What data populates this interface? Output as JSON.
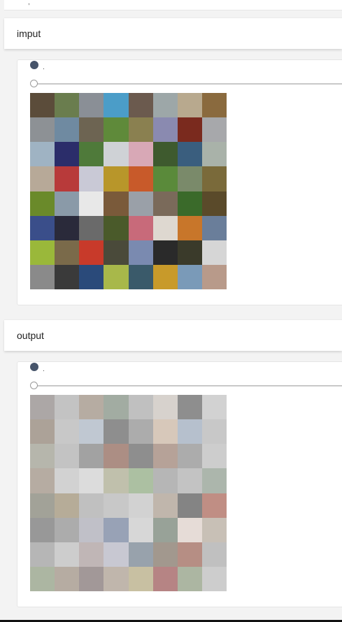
{
  "top": {
    "fragment": ","
  },
  "input_section": {
    "title": "imput",
    "radio_label": ".",
    "slider_value": 0,
    "grid_colors": [
      "#5b4c3a",
      "#6a7d4e",
      "#8a8f96",
      "#4b9dc8",
      "#6b5a4e",
      "#9da7a8",
      "#b8a98e",
      "#8a6a3e",
      "#8d9195",
      "#6f8aa1",
      "#6d6452",
      "#5f8a3a",
      "#8a8050",
      "#8a8ab0",
      "#7a2a1e",
      "#a7a8ab",
      "#9fb3c3",
      "#2b2d6a",
      "#4f7a3a",
      "#cfd2d6",
      "#d8a8b6",
      "#3e5a2e",
      "#3a5e7e",
      "#a9b2a9",
      "#b7a998",
      "#b83a3a",
      "#c9c9d6",
      "#b8962a",
      "#c85a2a",
      "#5a8a3a",
      "#7a8a6a",
      "#7a6a3a",
      "#6a8a2a",
      "#8a9aa8",
      "#e8e8e8",
      "#7a5a3a",
      "#9aa0a8",
      "#7a6a5a",
      "#3a6a2a",
      "#5a4a2a",
      "#3a4e8a",
      "#2a2a3a",
      "#6a6a6a",
      "#4a5a2a",
      "#c86a7a",
      "#ded8d0",
      "#c8762a",
      "#6a7e9a",
      "#9ab83a",
      "#7a6a4a",
      "#c83a2a",
      "#4a4a3a",
      "#7a8ab0",
      "#2a2a2a",
      "#3a3a2a",
      "#d6d6d6",
      "#8a8a8a",
      "#3a3a3a",
      "#2a4a7a",
      "#a8b84a",
      "#3a5a6a",
      "#c89a2a",
      "#7a9ab8",
      "#b89a8a"
    ]
  },
  "output_section": {
    "title": "output",
    "radio_label": ".",
    "slider_value": 0,
    "grid_colors": [
      "#7a7270",
      "#a0a0a0",
      "#8a7a6a",
      "#6a7a6a",
      "#9a9a9a",
      "#c0b8b0",
      "#4a4a4a",
      "#b8b8b8",
      "#7a6a5a",
      "#a8a8a8",
      "#9aa8b8",
      "#4a4a4a",
      "#7a7a7a",
      "#c0a890",
      "#8a9ab0",
      "#a8a8a8",
      "#8a8a7a",
      "#a0a0a0",
      "#6a6a6a",
      "#7a4a3a",
      "#4a4a4a",
      "#8a6a5a",
      "#7a7a7a",
      "#b0b0b0",
      "#8a7a6a",
      "#b8b8b8",
      "#c8c8c8",
      "#9a9a7a",
      "#7a9a6a",
      "#8a8a8a",
      "#a0a0a0",
      "#7a8a7a",
      "#6a6a5a",
      "#8a7a5a",
      "#9a9a9a",
      "#a8a8a8",
      "#b8b8b8",
      "#9a8a7a",
      "#3a3a3a",
      "#9a4a3a",
      "#5a5a5a",
      "#7a7a7a",
      "#9a9aa8",
      "#5a6a8a",
      "#c0c0c0",
      "#5a6a5a",
      "#d8c8c0",
      "#a89a8a",
      "#8a8a8a",
      "#b0b0b0",
      "#9a8a8a",
      "#a8a8b8",
      "#5a6a7a",
      "#6a5a4a",
      "#8a4a3a",
      "#9a9a9a",
      "#7a8a6a",
      "#8a7a6a",
      "#6a5a5a",
      "#9a8a7a",
      "#a89a6a",
      "#8a3a3a",
      "#7a8a6a",
      "#b0b0b0"
    ]
  }
}
